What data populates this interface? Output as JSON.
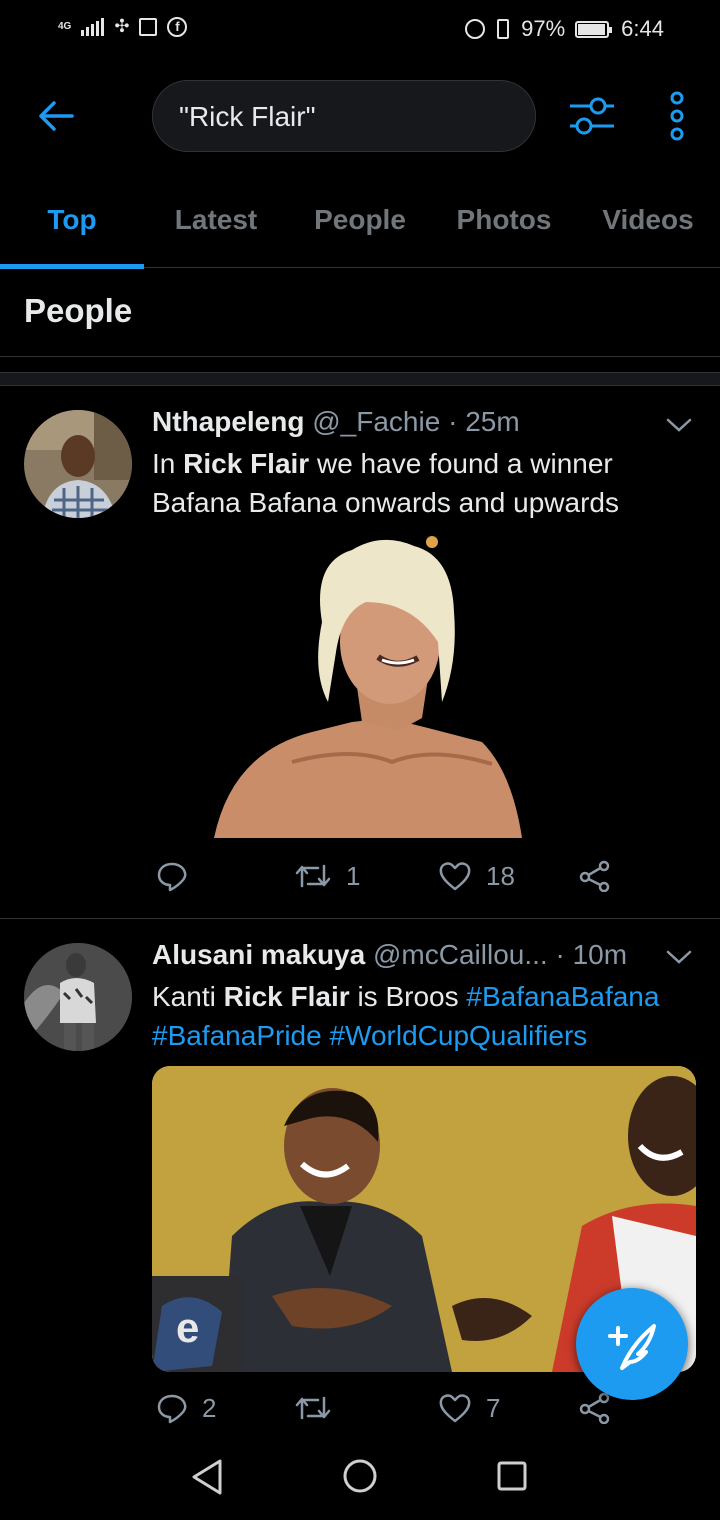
{
  "status_bar": {
    "network": "4G",
    "battery": "97%",
    "battery_level": 0.97,
    "time": "6:44"
  },
  "header": {
    "search_query": "\"Rick Flair\""
  },
  "tabs": [
    {
      "label": "Top",
      "active": true
    },
    {
      "label": "Latest",
      "active": false
    },
    {
      "label": "People",
      "active": false
    },
    {
      "label": "Photos",
      "active": false
    },
    {
      "label": "Videos",
      "active": false
    }
  ],
  "section": {
    "title": "People"
  },
  "tweets": [
    {
      "name": "Nthapeleng",
      "handle": "@_Fachie",
      "time": "25m",
      "text_before": "In ",
      "text_bold": "Rick Flair",
      "text_after": " we have found a winner Bafana Bafana onwards and upwards",
      "hashtags": [],
      "replies": "",
      "retweets": "1",
      "likes": "18"
    },
    {
      "name": "Alusani makuya",
      "handle": "@mcCaillou...",
      "time": "10m",
      "text_before": "Kanti ",
      "text_bold": "Rick Flair",
      "text_after": " is Broos ",
      "hashtags": [
        "#BafanaBafana",
        "#BafanaPride",
        "#WorldCupQualifiers"
      ],
      "replies": "2",
      "retweets": "",
      "likes": "7"
    }
  ],
  "icons": {
    "back": "arrow-left-icon",
    "filter": "sliders-icon",
    "more": "more-vertical-icon",
    "reply": "speech-bubble-icon",
    "retweet": "retweet-icon",
    "like": "heart-icon",
    "share": "share-icon",
    "compose": "compose-feather-icon"
  },
  "colors": {
    "accent": "#1d9bf0",
    "background": "#000000",
    "muted": "#8b98a5"
  }
}
